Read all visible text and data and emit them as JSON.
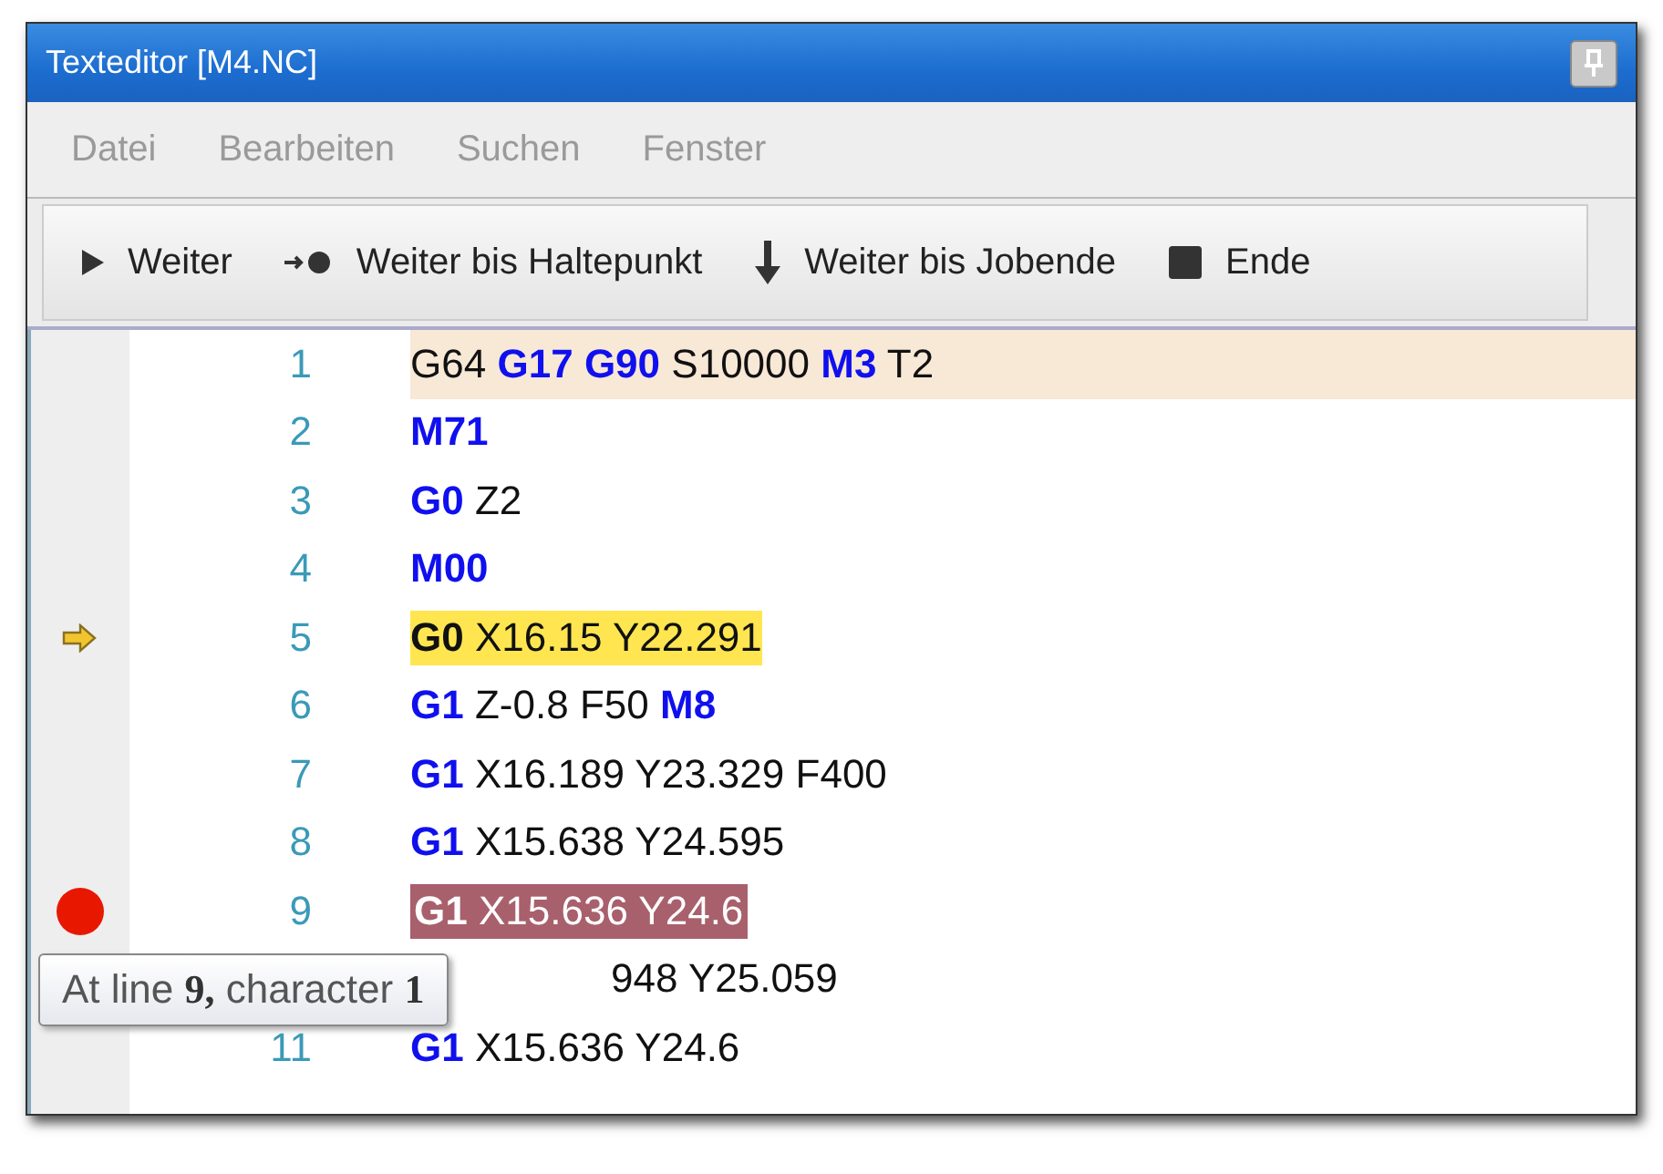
{
  "window": {
    "title": "Texteditor [M4.NC]"
  },
  "menu": [
    "Datei",
    "Bearbeiten",
    "Suchen",
    "Fenster"
  ],
  "toolbar": [
    {
      "kind": "play",
      "label": "Weiter"
    },
    {
      "kind": "to-breakpoint",
      "label": "Weiter bis Haltepunkt"
    },
    {
      "kind": "to-end",
      "label": "Weiter bis Jobende"
    },
    {
      "kind": "stop",
      "label": "Ende"
    }
  ],
  "lines": [
    {
      "number": "1",
      "current_line": true,
      "execution_point": false,
      "breakpoint": false,
      "tokens": [
        {
          "kind": "plain",
          "text": "G64"
        },
        {
          "kind": "keyword",
          "text": "G17"
        },
        {
          "kind": "keyword",
          "text": "G90"
        },
        {
          "kind": "plain",
          "text": "S10000"
        },
        {
          "kind": "keyword",
          "text": "M3"
        },
        {
          "kind": "plain",
          "text": "T2"
        }
      ]
    },
    {
      "number": "2",
      "current_line": false,
      "execution_point": false,
      "breakpoint": false,
      "tokens": [
        {
          "kind": "keyword",
          "text": "M71"
        }
      ]
    },
    {
      "number": "3",
      "current_line": false,
      "execution_point": false,
      "breakpoint": false,
      "tokens": [
        {
          "kind": "keyword",
          "text": "G0"
        },
        {
          "kind": "plain",
          "text": "Z2"
        }
      ]
    },
    {
      "number": "4",
      "current_line": false,
      "execution_point": false,
      "breakpoint": false,
      "tokens": [
        {
          "kind": "keyword",
          "text": "M00"
        }
      ]
    },
    {
      "number": "5",
      "current_line": false,
      "execution_point": true,
      "breakpoint": false,
      "tokens": [
        {
          "kind": "keyword",
          "text": "G0"
        },
        {
          "kind": "plain",
          "text": "X16.15"
        },
        {
          "kind": "plain",
          "text": "Y22.291"
        }
      ]
    },
    {
      "number": "6",
      "current_line": false,
      "execution_point": false,
      "breakpoint": false,
      "tokens": [
        {
          "kind": "keyword",
          "text": "G1"
        },
        {
          "kind": "plain",
          "text": "Z-0.8"
        },
        {
          "kind": "plain",
          "text": "F50"
        },
        {
          "kind": "keyword",
          "text": "M8"
        }
      ]
    },
    {
      "number": "7",
      "current_line": false,
      "execution_point": false,
      "breakpoint": false,
      "tokens": [
        {
          "kind": "keyword",
          "text": "G1"
        },
        {
          "kind": "plain",
          "text": "X16.189"
        },
        {
          "kind": "plain",
          "text": "Y23.329"
        },
        {
          "kind": "plain",
          "text": "F400"
        }
      ]
    },
    {
      "number": "8",
      "current_line": false,
      "execution_point": false,
      "breakpoint": false,
      "tokens": [
        {
          "kind": "keyword",
          "text": "G1"
        },
        {
          "kind": "plain",
          "text": "X15.638"
        },
        {
          "kind": "plain",
          "text": "Y24.595"
        }
      ]
    },
    {
      "number": "9",
      "current_line": false,
      "execution_point": false,
      "breakpoint": true,
      "tokens": [
        {
          "kind": "keyword",
          "text": "G1"
        },
        {
          "kind": "plain",
          "text": "X15.636"
        },
        {
          "kind": "plain",
          "text": "Y24.6"
        }
      ]
    },
    {
      "covered_by_tooltip": true,
      "current_line": false,
      "execution_point": false,
      "breakpoint": false,
      "tokens": [
        {
          "kind": "plain",
          "text": "948"
        },
        {
          "kind": "plain",
          "text": "Y25.059"
        }
      ]
    },
    {
      "number": "11",
      "current_line": false,
      "execution_point": false,
      "breakpoint": false,
      "tokens": [
        {
          "kind": "keyword",
          "text": "G1"
        },
        {
          "kind": "plain",
          "text": "X15.636"
        },
        {
          "kind": "plain",
          "text": "Y24.6"
        }
      ]
    }
  ],
  "tooltip": "At line **9,** character **1**"
}
